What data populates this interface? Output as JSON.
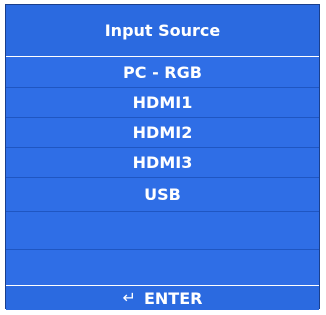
{
  "menu": {
    "title": "Input Source",
    "items": [
      {
        "label": "PC - RGB"
      },
      {
        "label": "HDMI1"
      },
      {
        "label": "HDMI2"
      },
      {
        "label": "HDMI3"
      },
      {
        "label": "USB"
      }
    ],
    "footer": {
      "icon": "enter-arrow-icon",
      "label": "ENTER"
    }
  },
  "colors": {
    "panel": "#2f6ee6",
    "border": "#1a3f8c",
    "text": "#ffffff"
  }
}
